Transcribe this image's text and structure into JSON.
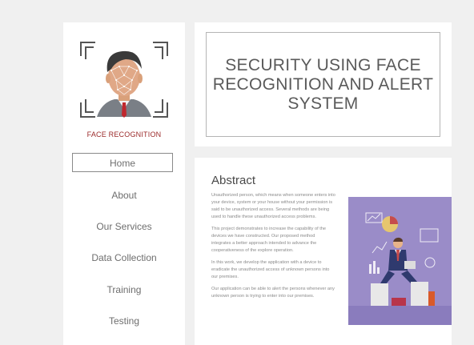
{
  "logo": {
    "caption": "FACE RECOGNITION"
  },
  "nav": {
    "items": [
      {
        "label": "Home"
      },
      {
        "label": "About"
      },
      {
        "label": "Our Services"
      },
      {
        "label": "Data Collection"
      },
      {
        "label": "Training"
      },
      {
        "label": "Testing"
      }
    ]
  },
  "header": {
    "title": "SECURITY USING FACE RECOGNITION AND ALERT SYSTEM"
  },
  "content": {
    "heading": "Abstract",
    "paragraphs": [
      "Unauthorized person, which means when someone enters into your device, system or your house without your permission is said to be unauthorized access. Several methods are being used to handle these unauthorized access problems.",
      "This project demonstrates to increase the capability of the devices we have constructed. Our proposed method integrates a better approach intended to advance the cooperativeness of the explore operation.",
      "In this work, we develop the application with a device to eradicate the unauthorized access of unknown persons into our premises.",
      "Our application can be able to alert the persons whenever any unknown person is trying to enter into our premises."
    ]
  },
  "colors": {
    "page_bg": "#f0f0f0",
    "card_bg": "#ffffff",
    "illustration_bg": "#9a8cc8",
    "caption_red": "#9b2a2a"
  }
}
